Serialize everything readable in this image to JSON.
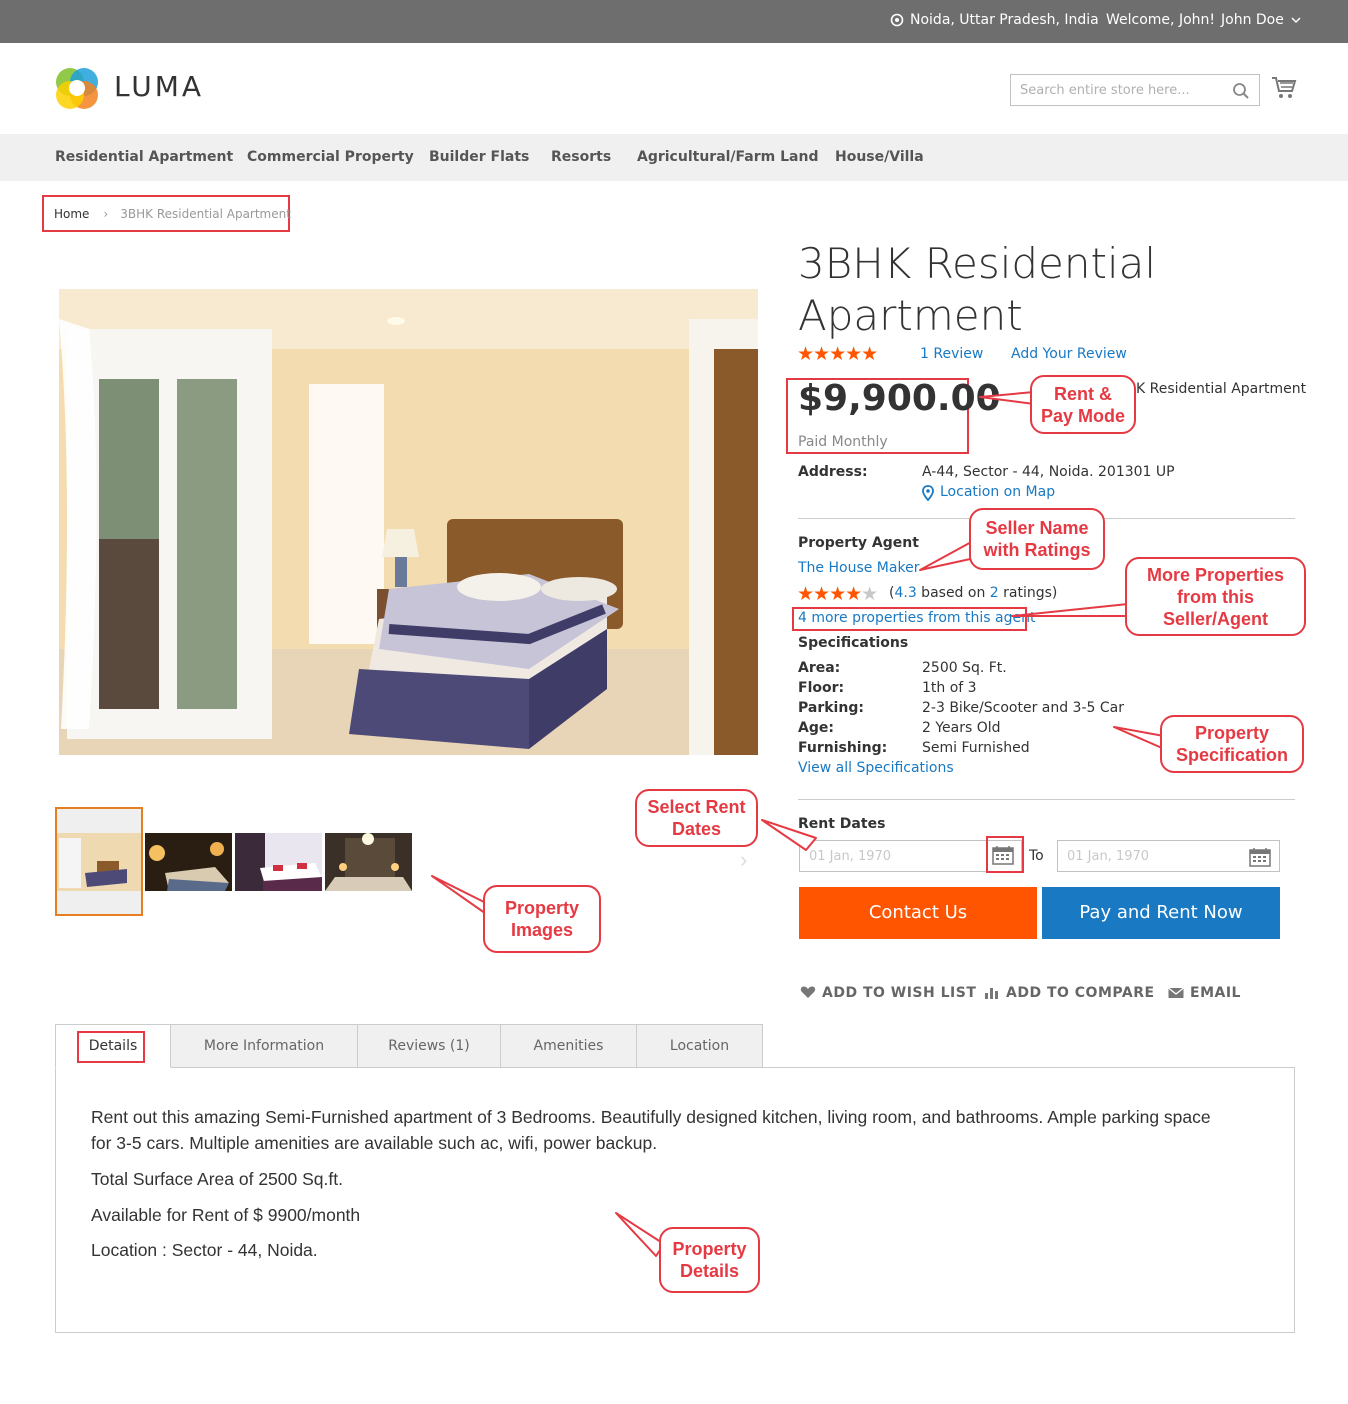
{
  "topbar": {
    "location": "Noida, Uttar Pradesh, India",
    "welcome": "Welcome, John!",
    "user": "John Doe"
  },
  "header": {
    "logo_text": "LUMA",
    "search_placeholder": "Search entire store here..."
  },
  "nav": [
    "Residential Apartment",
    "Commercial Property",
    "Builder Flats",
    "Resorts",
    "Agricultural/Farm Land",
    "House/Villa"
  ],
  "breadcrumb": {
    "home": "Home",
    "current": "3BHK Residential Apartment"
  },
  "product": {
    "title": "3BHK Residential Apartment",
    "rating_stars": "★★★★★",
    "review_count_link": "1 Review",
    "add_review_link": "Add Your Review",
    "price": "$9,900.00",
    "pay_mode": "Paid Monthly",
    "hidden_sku_fragment": "K Residential Apartment",
    "address_label": "Address:",
    "address_value": "A-44, Sector - 44, Noida. 201301 UP",
    "map_link": "Location on Map",
    "agent_heading": "Property Agent",
    "agent_name": "The House Maker",
    "agent_stars": "★★★★",
    "agent_star_empty": "★",
    "agent_rating_open": "(",
    "agent_rating_value": "4.3",
    "agent_rating_mid": " based on ",
    "agent_rating_count": "2",
    "agent_rating_close": " ratings)",
    "more_properties_link": "4 more properties from this agent",
    "specs_heading": "Specifications",
    "specs": [
      {
        "label": "Area:",
        "value": "2500 Sq. Ft."
      },
      {
        "label": "Floor:",
        "value": "1th of 3"
      },
      {
        "label": "Parking:",
        "value": "2-3 Bike/Scooter and 3-5 Car"
      },
      {
        "label": "Age:",
        "value": "2 Years Old"
      },
      {
        "label": "Furnishing:",
        "value": "Semi Furnished"
      }
    ],
    "view_specs_link": "View all Specifications",
    "rent_dates_heading": "Rent Dates",
    "date_from_placeholder": "01 Jan, 1970",
    "date_to_label": "To",
    "date_to_placeholder": "01 Jan, 1970",
    "contact_button": "Contact Us",
    "pay_button": "Pay and Rent Now",
    "wishlist": "ADD TO WISH LIST",
    "compare": "ADD TO COMPARE",
    "email": "EMAIL"
  },
  "tabs": [
    "Details",
    "More Information",
    "Reviews (1)",
    "Amenities",
    "Location"
  ],
  "details": {
    "p1_line1": "Rent out this amazing Semi-Furnished apartment of 3 Bedrooms. Beautifully designed kitchen, living room, and bathrooms. Ample parking space",
    "p1_line2": "for 3-5 cars. Multiple amenities are available such ac, wifi, power backup.",
    "p2": "Total Surface Area of 2500 Sq.ft.",
    "p3": "Available for Rent of $ 9900/month",
    "p4": "Location : Sector - 44, Noida."
  },
  "callouts": {
    "rent_pay": [
      "Rent &",
      "Pay Mode"
    ],
    "seller": [
      "Seller Name",
      "with Ratings"
    ],
    "more_props": [
      "More Properties",
      "from this",
      "Seller/Agent"
    ],
    "spec": [
      "Property",
      "Specification"
    ],
    "rent_dates": [
      "Select Rent",
      "Dates"
    ],
    "images": [
      "Property",
      "Images"
    ],
    "details": [
      "Property",
      "Details"
    ]
  },
  "colors": {
    "accent_orange": "#ff5501",
    "accent_blue": "#1979c3",
    "callout_red": "#e53a43",
    "star_orange": "#ff5501",
    "topbar": "#6e6e6e"
  }
}
